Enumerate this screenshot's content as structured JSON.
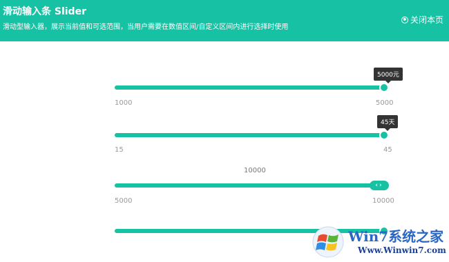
{
  "header": {
    "title": "滑动输入条 Slider",
    "subtitle": "滑动型输入器，展示当前值和可选范围，当用户需要在数值区间/自定义区间内进行选择时使用",
    "close_label": "关闭本页"
  },
  "colors": {
    "accent": "#16c2a3",
    "tooltip_bg": "#333333",
    "track": "#e6e6e6",
    "label": "#999999"
  },
  "sliders": [
    {
      "min": "1000",
      "max": "5000",
      "value": 5000,
      "tooltip": "5000元"
    },
    {
      "min": "15",
      "max": "45",
      "value": 45,
      "tooltip": "45天"
    },
    {
      "min": "5000",
      "max": "10000",
      "value": 10000,
      "value_label": "10000",
      "handle_icon": "left-right-arrows-icon"
    },
    {
      "value_fraction": 1.0
    }
  ],
  "watermark": {
    "text": "Win7系统之家",
    "url": "Www.Winwin7.com",
    "icon": "windows-logo-icon"
  }
}
